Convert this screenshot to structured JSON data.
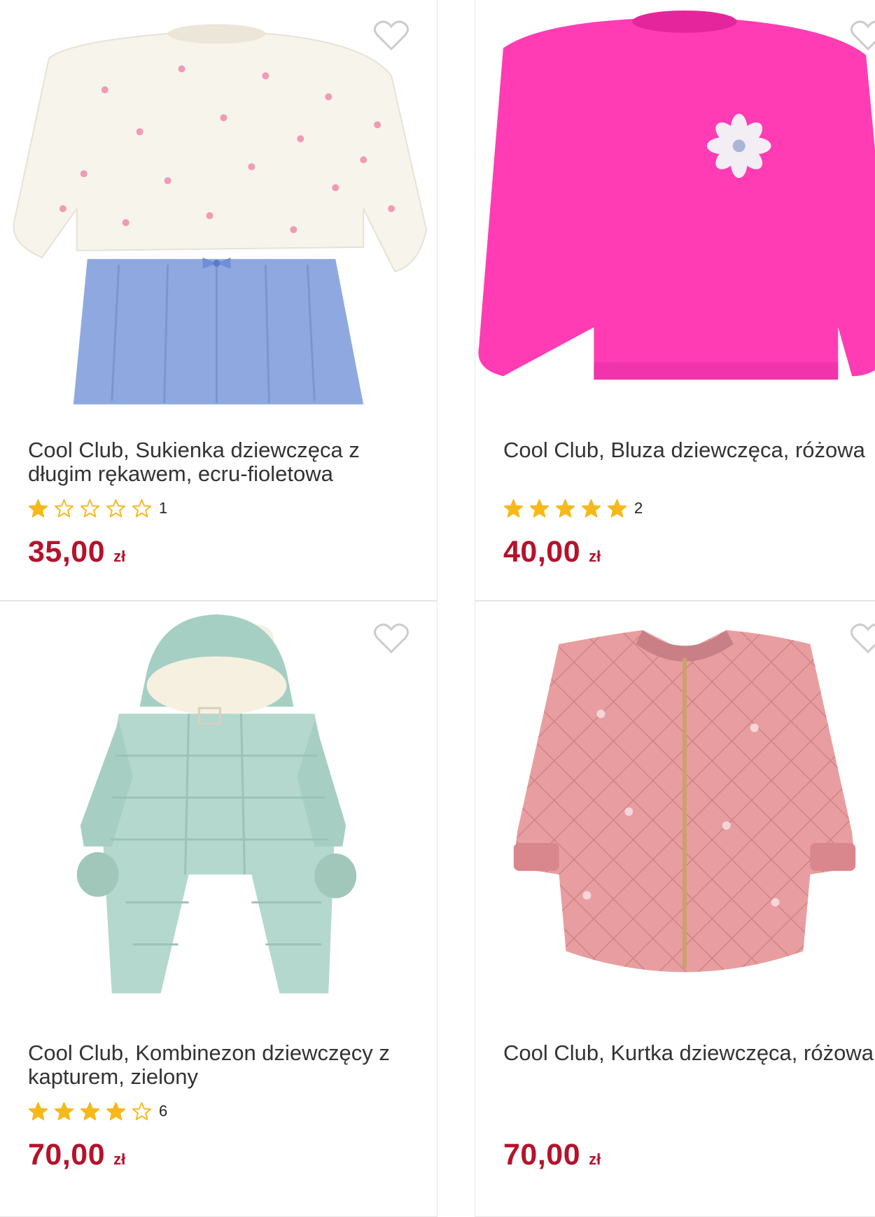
{
  "products": [
    {
      "title": "Cool Club, Sukienka dziewczęca z długim rękawem, ecru-fioletowa",
      "rating": 1,
      "rating_count": "1",
      "price": "35,00",
      "currency": "zł"
    },
    {
      "title": "Cool Club, Bluza dziewczęca, różowa",
      "rating": 5,
      "rating_count": "2",
      "price": "40,00",
      "currency": "zł"
    },
    {
      "title": "Cool Club, Kombinezon dziewczęcy z kapturem, zielony",
      "rating": 4,
      "rating_count": "6",
      "price": "70,00",
      "currency": "zł"
    },
    {
      "title": "Cool Club, Kurtka dziewczęca, różowa",
      "rating": null,
      "rating_count": "",
      "price": "70,00",
      "currency": "zł"
    }
  ],
  "colors": {
    "price": "#b5122b",
    "star": "#f6b81b",
    "text": "#333333",
    "heart": "#cccccc"
  },
  "icons": {
    "favorite": "heart-outline-icon",
    "rating": "star-icon"
  }
}
